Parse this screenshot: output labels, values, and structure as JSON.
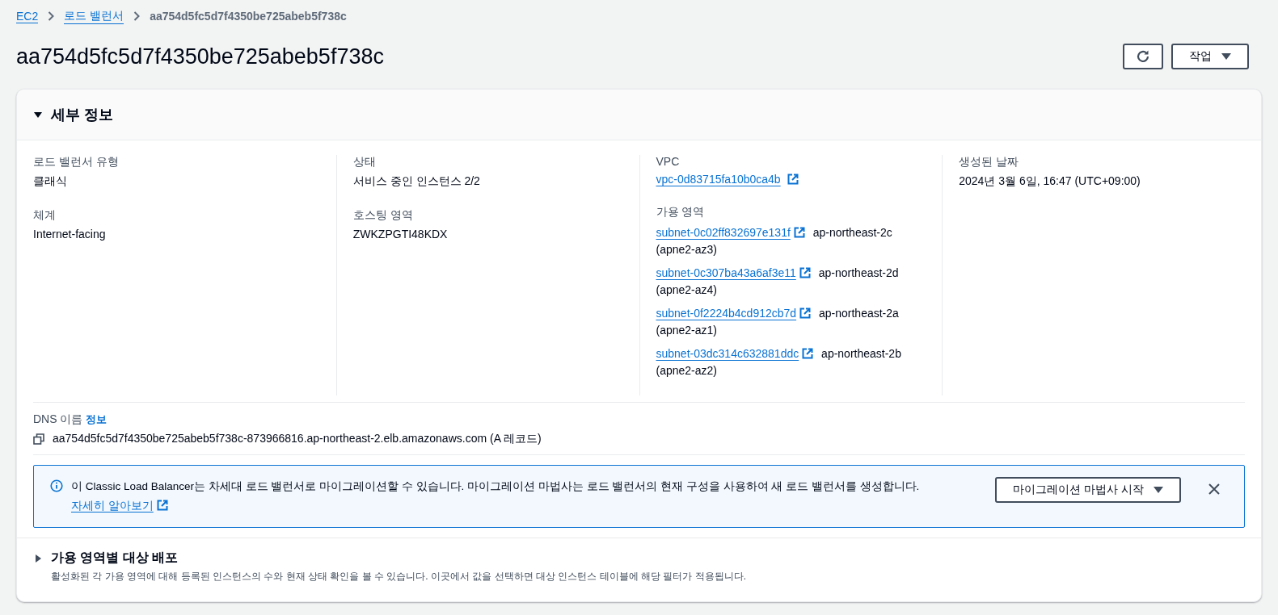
{
  "breadcrumbs": [
    {
      "label": "EC2",
      "link": true
    },
    {
      "label": "로드 밸런서",
      "link": true
    },
    {
      "label": "aa754d5fc5d7f4350be725abeb5f738c",
      "link": false
    }
  ],
  "title": "aa754d5fc5d7f4350be725abeb5f738c",
  "actions": {
    "menu_label": "작업"
  },
  "details": {
    "heading": "세부 정보",
    "expanded": true,
    "columns": [
      [
        {
          "kind": "text",
          "label": "로드 밸런서 유형",
          "value": "클래식"
        },
        {
          "kind": "text",
          "label": "체계",
          "value": "Internet-facing"
        }
      ],
      [
        {
          "kind": "text",
          "label": "상태",
          "value": "서비스 중인 인스턴스 2/2"
        },
        {
          "kind": "text",
          "label": "호스팅 영역",
          "value": "ZWKZPGTI48KDX"
        }
      ],
      [
        {
          "kind": "link",
          "label": "VPC",
          "value": "vpc-0d83715fa10b0ca4b"
        },
        {
          "kind": "subnets",
          "label": "가용 영역",
          "subnets": [
            {
              "id": "subnet-0c02ff832697e131f",
              "zone": "ap-northeast-2c",
              "az": "(apne2-az3)"
            },
            {
              "id": "subnet-0c307ba43a6af3e11",
              "zone": "ap-northeast-2d",
              "az": "(apne2-az4)"
            },
            {
              "id": "subnet-0f2224b4cd912cb7d",
              "zone": "ap-northeast-2a",
              "az": "(apne2-az1)"
            },
            {
              "id": "subnet-03dc314c632881ddc",
              "zone": "ap-northeast-2b",
              "az": "(apne2-az2)"
            }
          ]
        }
      ],
      [
        {
          "kind": "text",
          "label": "생성된 날짜",
          "value": "2024년 3월 6일, 16:47 (UTC+09:00)"
        }
      ]
    ]
  },
  "dns": {
    "label": "DNS 이름",
    "info": "정보",
    "value": "aa754d5fc5d7f4350be725abeb5f738c-873966816.ap-northeast-2.elb.amazonaws.com (A 레코드)"
  },
  "alert": {
    "text": "이 Classic Load Balancer는 차세대 로드 밸런서로 마이그레이션할 수 있습니다. 마이그레이션 마법사는 로드 밸런서의 현재 구성을 사용하여 새 로드 밸런서를 생성합니다.",
    "link": "자세히 알아보기",
    "button": "마이그레이션 마법사 시작"
  },
  "distribution": {
    "heading": "가용 영역별 대상 배포",
    "expanded": false,
    "description": "활성화된 각 가용 영역에 대해 등록된 인스턴스의 수와 현재 상태 확인을 볼 수 있습니다. 이곳에서 값을 선택하면 대상 인스턴스 테이블에 해당 필터가 적용됩니다."
  }
}
